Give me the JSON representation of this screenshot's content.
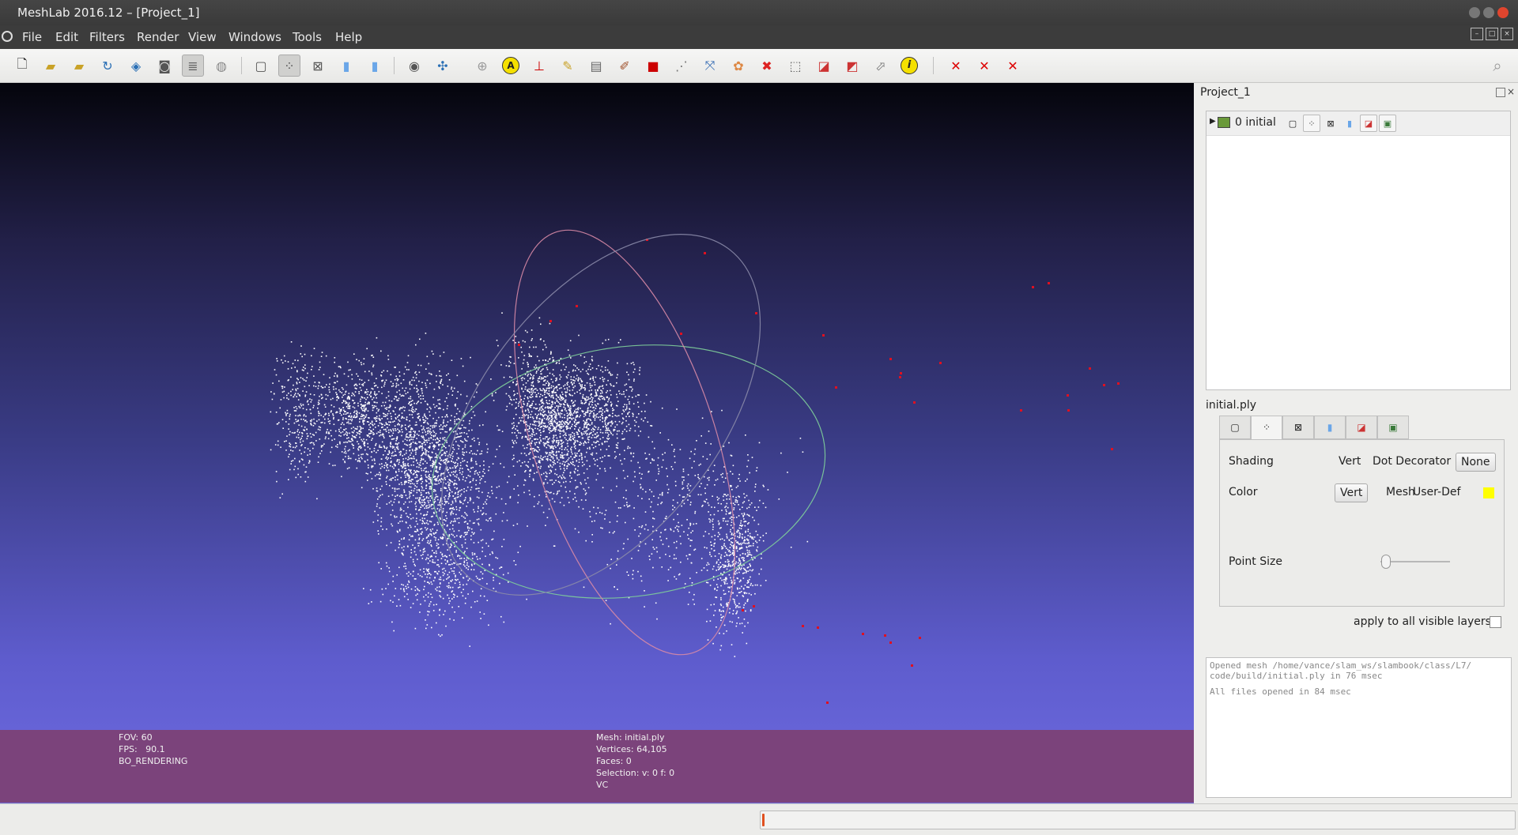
{
  "window": {
    "title": "MeshLab 2016.12 – [Project_1]"
  },
  "menu": [
    "File",
    "Edit",
    "Filters",
    "Render",
    "View",
    "Windows",
    "Tools",
    "Help"
  ],
  "toolbar": {
    "icons": [
      "new-project-icon",
      "open-project-icon",
      "open-mesh-icon",
      "reload-icon",
      "export-mesh-icon",
      "snapshot-icon",
      "layers-icon",
      "layer-dialog-icon",
      "bbox-icon",
      "points-icon",
      "wireframe-icon",
      "flat-icon",
      "smooth-icon",
      "light-icon",
      "axis-icon",
      "sphere-icon",
      "annotation-icon",
      "measure-icon",
      "paint-icon",
      "screenshot-icon",
      "brush-icon",
      "select-icon",
      "align-icon",
      "manipulator-icon",
      "color-icon",
      "georef-icon",
      "select-faces-icon",
      "select-vertices-icon",
      "select-connected-icon",
      "select-area-icon",
      "info-icon",
      "delete-faces-icon",
      "delete-vertices-icon",
      "delete-all-icon",
      "search-icon"
    ]
  },
  "viewport": {
    "info_left": [
      "FOV: 60",
      "FPS:   90.1",
      "BO_RENDERING"
    ],
    "info_mid": [
      "Mesh: initial.ply",
      "Vertices: 64,105",
      "Faces: 0",
      "Selection: v: 0 f: 0",
      "VC"
    ]
  },
  "project": {
    "name": "Project_1",
    "layer_label": "0  initial",
    "mesh_name": "initial.ply"
  },
  "render_panel": {
    "shading_label": "Shading",
    "shading_vert": "Vert",
    "dot_decorator_label": "Dot Decorator",
    "dot_decorator_value": "None",
    "color_label": "Color",
    "color_vert": "Vert",
    "color_mesh": "Mesh",
    "color_userdef": "User-Def",
    "userdef_color": "#ffff00",
    "point_size_label": "Point Size",
    "point_size_level": 0.05,
    "apply_all_label": "apply to all visible layers"
  },
  "log": [
    "Opened mesh /home/vance/slam_ws/slambook/class/L7/",
    "code/build/initial.ply in 76 msec",
    "All files opened in 84 msec"
  ],
  "status": {
    "progress": 0.003
  }
}
